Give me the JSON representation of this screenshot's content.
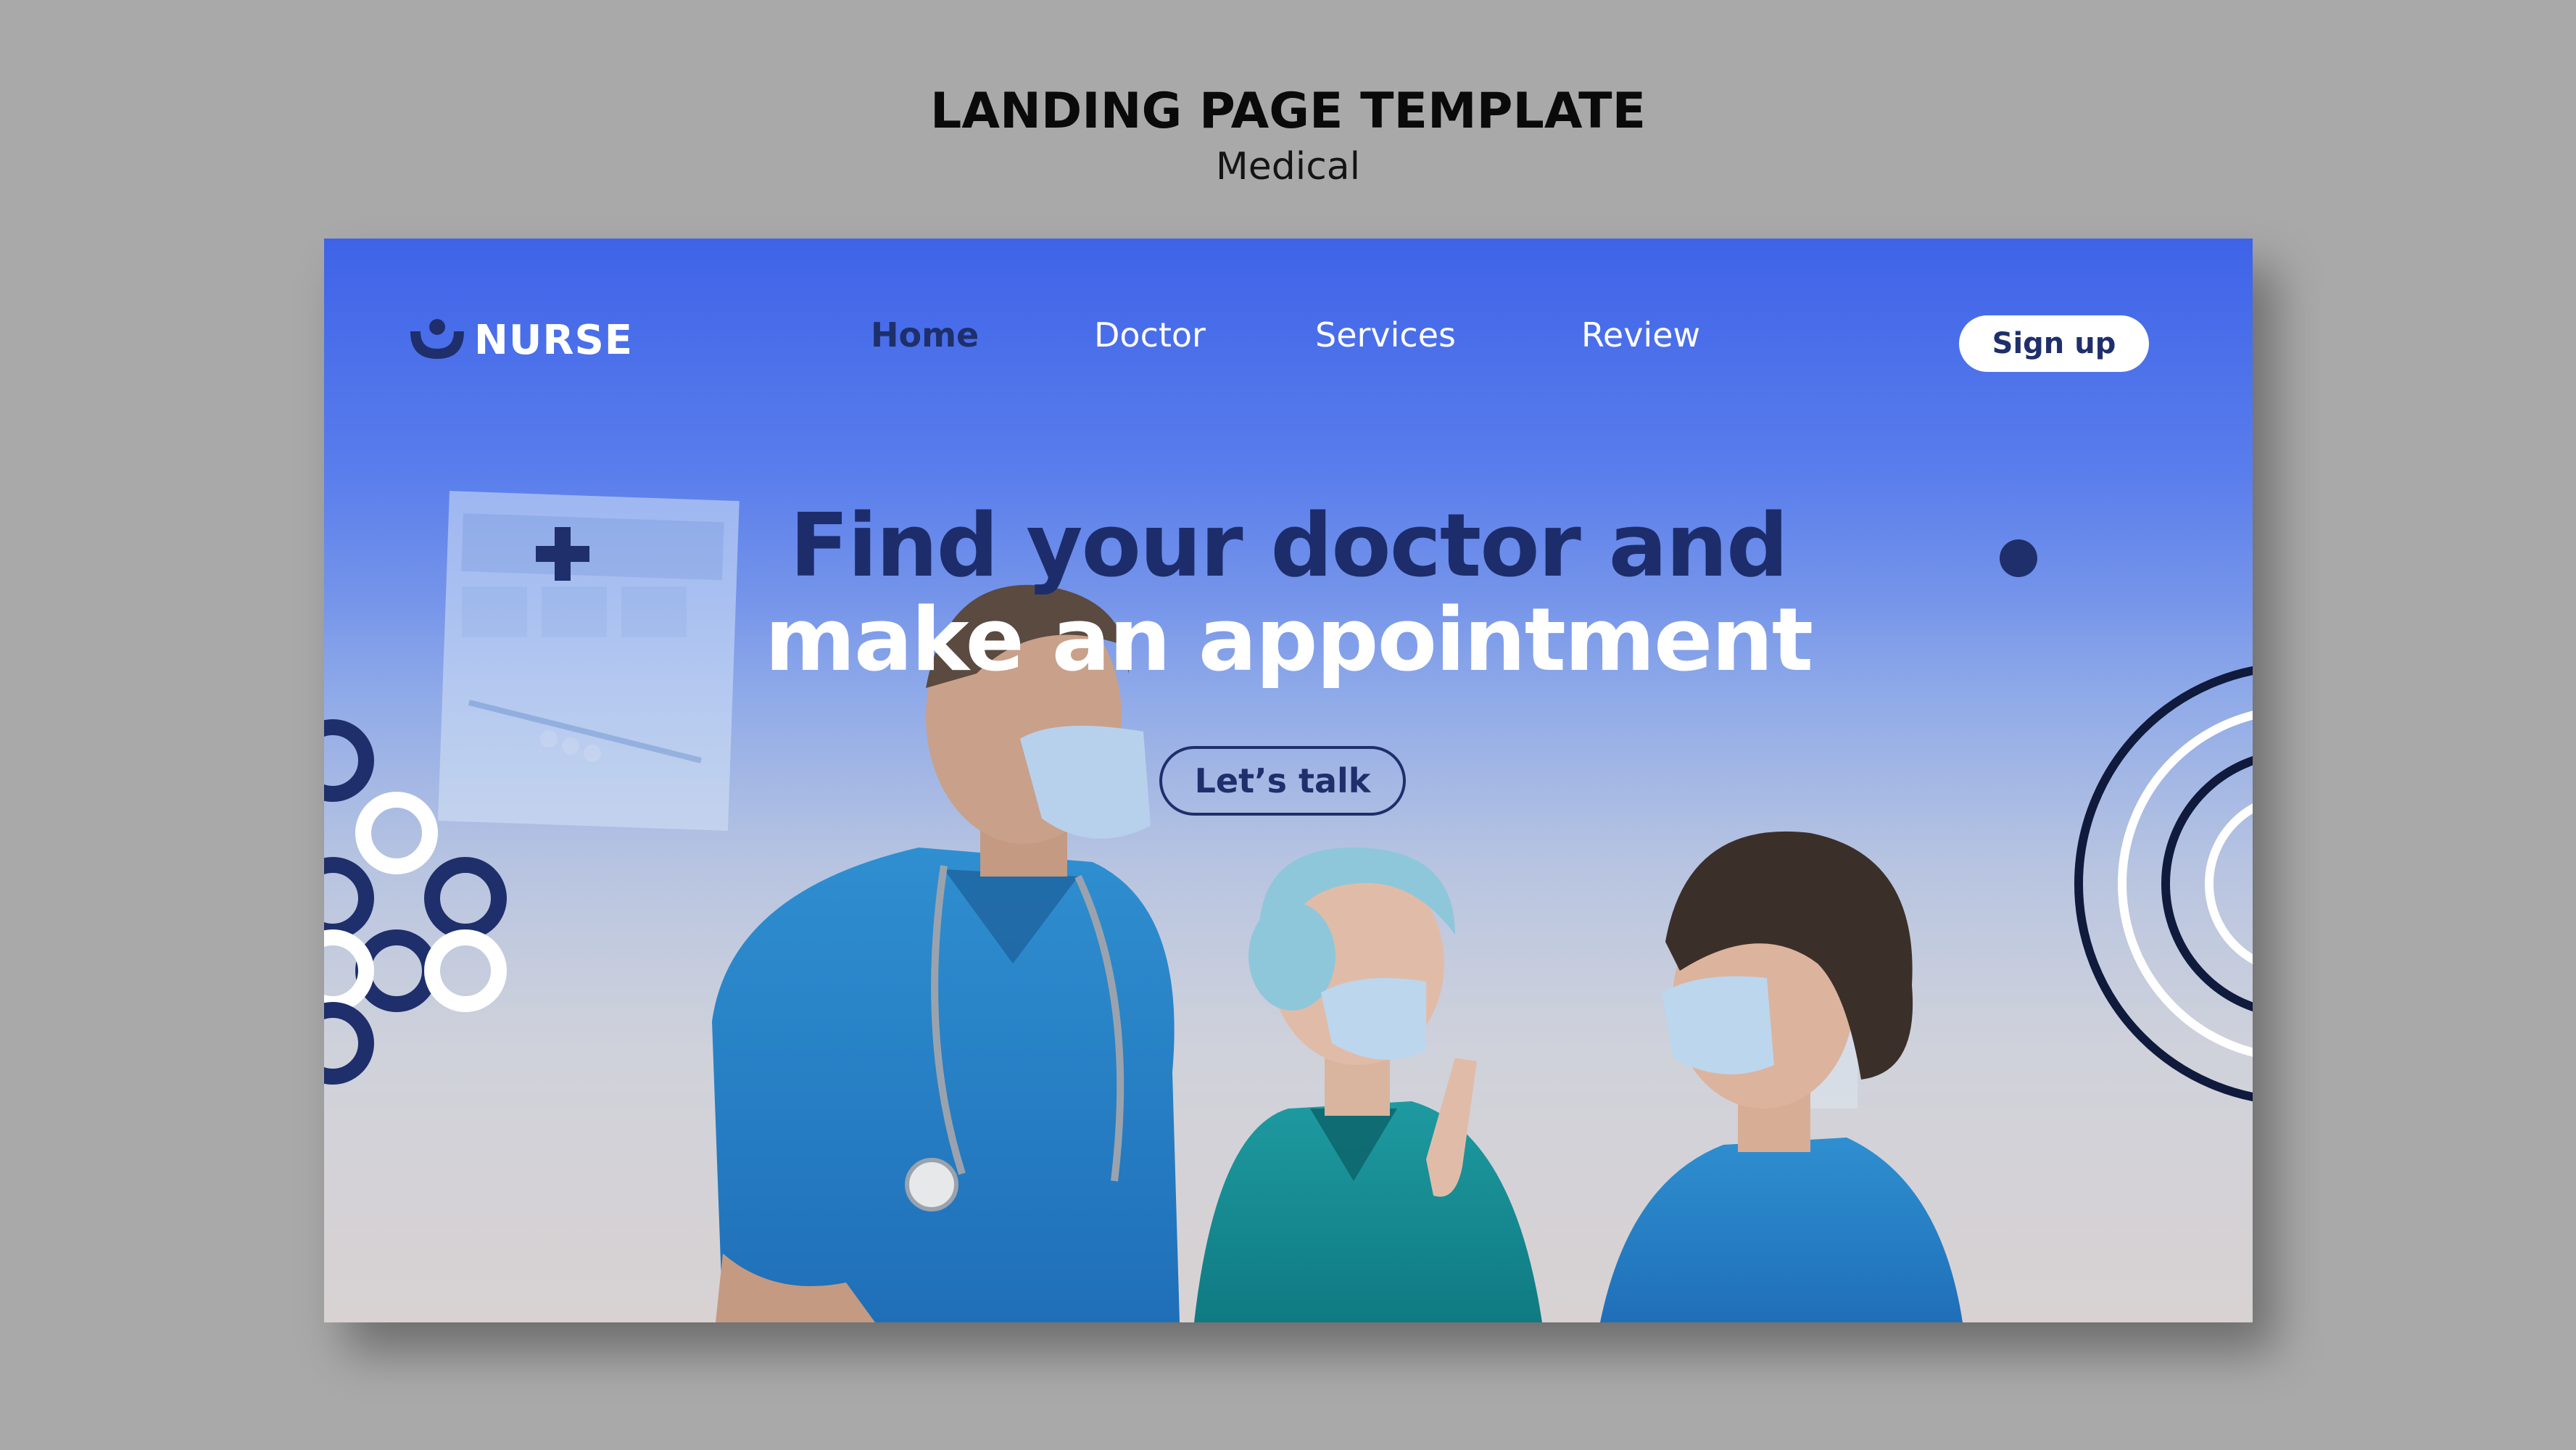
{
  "header": {
    "title": "LANDING PAGE TEMPLATE",
    "subtitle": "Medical"
  },
  "brand": {
    "name": "NURSE",
    "icon": "nurse-logo-icon"
  },
  "nav": {
    "items": [
      {
        "label": "Home",
        "active": true
      },
      {
        "label": "Doctor",
        "active": false
      },
      {
        "label": "Services",
        "active": false
      },
      {
        "label": "Review",
        "active": false
      }
    ],
    "signup_label": "Sign up"
  },
  "hero": {
    "title_line1": "Find your doctor and",
    "title_line2": "make an appointment",
    "cta_label": "Let’s talk"
  },
  "colors": {
    "gradient_top": "#3e63e8",
    "gradient_bottom": "#cfcacb",
    "navy_accent": "#1e2f6b",
    "page_background": "#a9a9a9",
    "active_nav": "#1e2f6b"
  }
}
